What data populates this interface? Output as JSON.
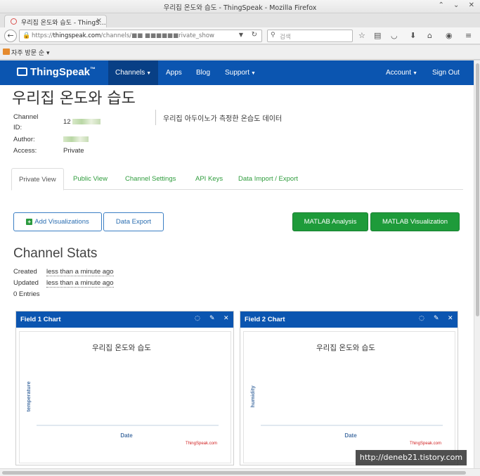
{
  "window": {
    "title": "우리집 온도와 습도 - ThingSpeak - Mozilla Firefox",
    "controls": [
      "⌃",
      "⌄",
      "✕"
    ]
  },
  "browser": {
    "tab_title": "우리집 온도와 습도 - ThingS…",
    "tab_close": "×",
    "new_tab": "+",
    "back": "←",
    "url_prefix": "https://",
    "url_host": "thingspeak.com",
    "url_path": "/channels/■■ ■■■■■■rivate_show",
    "search_placeholder": "검색",
    "bookmark_folder": "자주 방문 순 ▾",
    "toolbar_icons": [
      "star-icon",
      "reader-icon",
      "pocket-icon",
      "download-icon",
      "home-icon",
      "chat-icon",
      "menu-icon"
    ]
  },
  "site": {
    "logo": "ThingSpeak",
    "logo_tm": "™",
    "nav": {
      "channels": "Channels",
      "apps": "Apps",
      "blog": "Blog",
      "support": "Support",
      "account": "Account",
      "signout": "Sign Out"
    }
  },
  "channel": {
    "title": "우리집 온도와 습도",
    "id_label_1": "Channel",
    "id_label_2": "ID:",
    "id_value": "12",
    "author_label": "Author:",
    "access_label": "Access:",
    "access_value": "Private",
    "description": "우리집 아두이노가 측정한 온습도 데이터"
  },
  "tabs": {
    "private": "Private View",
    "public": "Public View",
    "settings": "Channel Settings",
    "apikeys": "API Keys",
    "import": "Data Import / Export"
  },
  "buttons": {
    "add_vis": "Add Visualizations",
    "export": "Data Export",
    "matlab_analysis": "MATLAB Analysis",
    "matlab_vis": "MATLAB Visualization"
  },
  "stats": {
    "title": "Channel Stats",
    "created_label": "Created",
    "created_value": "less than a minute ago",
    "updated_label": "Updated",
    "updated_value": "less than a minute ago",
    "entries": "0 Entries"
  },
  "charts": [
    {
      "panel_title": "Field 1 Chart",
      "chart_title": "우리집 온도와 습도",
      "ylabel": "temperature",
      "xlabel": "Date",
      "credit": "ThingSpeak.com"
    },
    {
      "panel_title": "Field 2 Chart",
      "chart_title": "우리집 온도와 습도",
      "ylabel": "humidity",
      "xlabel": "Date",
      "credit": "ThingSpeak.com"
    }
  ],
  "chart_data": [
    {
      "type": "line",
      "title": "우리집 온도와 습도",
      "xlabel": "Date",
      "ylabel": "temperature",
      "series": []
    },
    {
      "type": "line",
      "title": "우리집 온도와 습도",
      "xlabel": "Date",
      "ylabel": "humidity",
      "series": []
    }
  ],
  "watermark": "http://deneb21.tistory.com"
}
